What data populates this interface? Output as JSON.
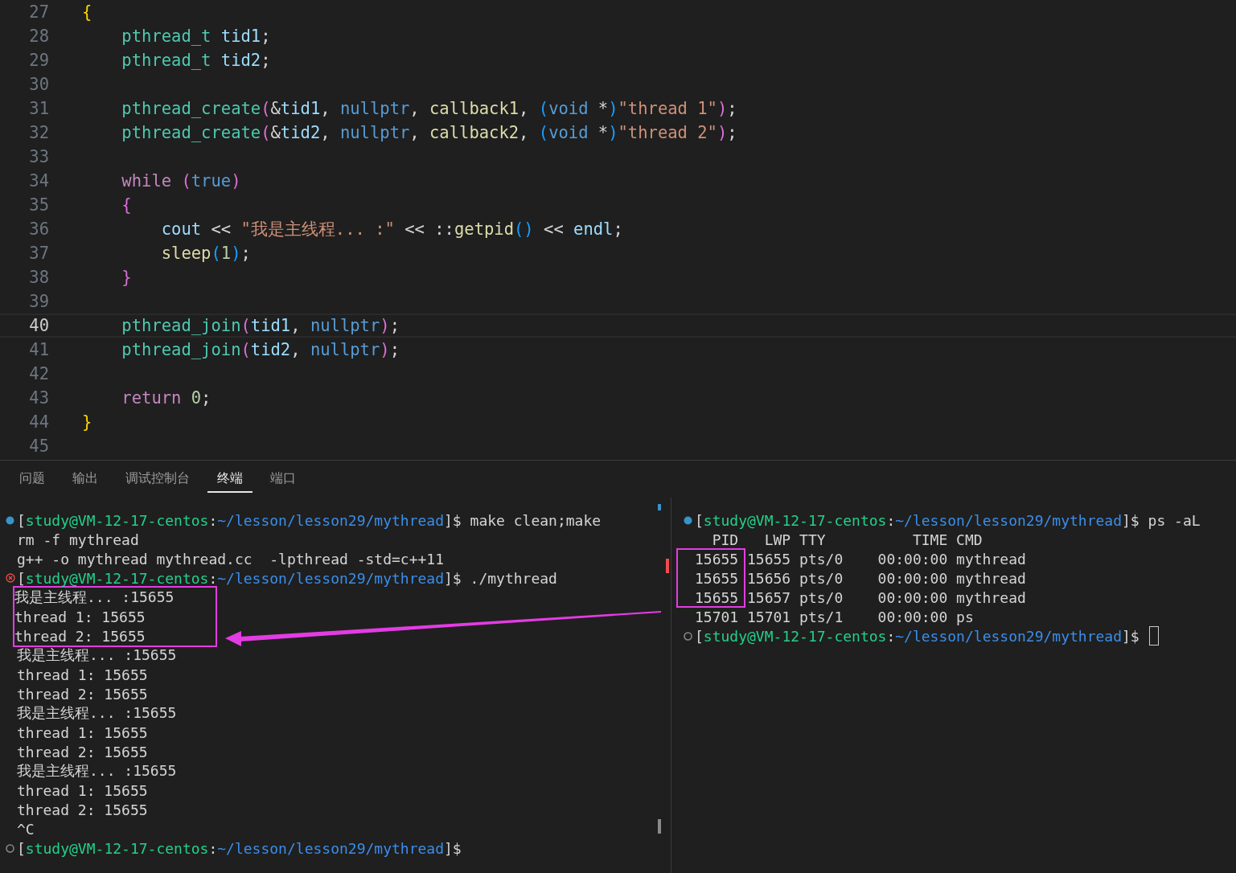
{
  "editor": {
    "lines": [
      {
        "number": "27",
        "current": false,
        "tokens": [
          {
            "kind": "b1",
            "text": "{"
          }
        ]
      },
      {
        "number": "28",
        "current": false,
        "tokens": [
          {
            "kind": "type",
            "text": "    pthread_t"
          },
          {
            "kind": "var",
            "text": " tid1"
          },
          {
            "kind": "p",
            "text": ";"
          }
        ]
      },
      {
        "number": "29",
        "current": false,
        "tokens": [
          {
            "kind": "type",
            "text": "    pthread_t"
          },
          {
            "kind": "var",
            "text": " tid2"
          },
          {
            "kind": "p",
            "text": ";"
          }
        ]
      },
      {
        "number": "30",
        "current": false
      },
      {
        "number": "31",
        "current": false,
        "tokens": [
          {
            "kind": "type",
            "text": "    pthread_create"
          },
          {
            "kind": "b2",
            "text": "("
          },
          {
            "kind": "p",
            "text": "&"
          },
          {
            "kind": "var",
            "text": "tid1"
          },
          {
            "kind": "p",
            "text": ","
          },
          {
            "kind": "kw",
            "text": " nullptr"
          },
          {
            "kind": "p",
            "text": ","
          },
          {
            "kind": "func",
            "text": " callback1"
          },
          {
            "kind": "p",
            "text": ","
          },
          {
            "kind": "b3",
            "text": " ("
          },
          {
            "kind": "kw",
            "text": "void"
          },
          {
            "kind": "p",
            "text": " *"
          },
          {
            "kind": "b3",
            "text": ")"
          },
          {
            "kind": "str",
            "text": "\"thread 1\""
          },
          {
            "kind": "b2",
            "text": ")"
          },
          {
            "kind": "p",
            "text": ";"
          }
        ]
      },
      {
        "number": "32",
        "current": false,
        "tokens": [
          {
            "kind": "type",
            "text": "    pthread_create"
          },
          {
            "kind": "b2",
            "text": "("
          },
          {
            "kind": "p",
            "text": "&"
          },
          {
            "kind": "var",
            "text": "tid2"
          },
          {
            "kind": "p",
            "text": ","
          },
          {
            "kind": "kw",
            "text": " nullptr"
          },
          {
            "kind": "p",
            "text": ","
          },
          {
            "kind": "func",
            "text": " callback2"
          },
          {
            "kind": "p",
            "text": ","
          },
          {
            "kind": "b3",
            "text": " ("
          },
          {
            "kind": "kw",
            "text": "void"
          },
          {
            "kind": "p",
            "text": " *"
          },
          {
            "kind": "b3",
            "text": ")"
          },
          {
            "kind": "str",
            "text": "\"thread 2\""
          },
          {
            "kind": "b2",
            "text": ")"
          },
          {
            "kind": "p",
            "text": ";"
          }
        ]
      },
      {
        "number": "33",
        "current": false
      },
      {
        "number": "34",
        "current": false,
        "tokens": [
          {
            "kind": "ctrl",
            "text": "    while"
          },
          {
            "kind": "b2",
            "text": " ("
          },
          {
            "kind": "kw",
            "text": "true"
          },
          {
            "kind": "b2",
            "text": ")"
          }
        ]
      },
      {
        "number": "35",
        "current": false,
        "tokens": [
          {
            "kind": "b2",
            "text": "    {"
          }
        ]
      },
      {
        "number": "36",
        "current": false,
        "tokens": [
          {
            "kind": "var",
            "text": "        cout"
          },
          {
            "kind": "p",
            "text": " << "
          },
          {
            "kind": "str",
            "text": "\"我是主线程... :\""
          },
          {
            "kind": "p",
            "text": " << ::"
          },
          {
            "kind": "func",
            "text": "getpid"
          },
          {
            "kind": "b3",
            "text": "()"
          },
          {
            "kind": "p",
            "text": " << "
          },
          {
            "kind": "var",
            "text": "endl"
          },
          {
            "kind": "p",
            "text": ";"
          }
        ]
      },
      {
        "number": "37",
        "current": false,
        "tokens": [
          {
            "kind": "func",
            "text": "        sleep"
          },
          {
            "kind": "b3",
            "text": "("
          },
          {
            "kind": "num",
            "text": "1"
          },
          {
            "kind": "b3",
            "text": ")"
          },
          {
            "kind": "p",
            "text": ";"
          }
        ]
      },
      {
        "number": "38",
        "current": false,
        "tokens": [
          {
            "kind": "b2",
            "text": "    }"
          }
        ]
      },
      {
        "number": "39",
        "current": false
      },
      {
        "number": "40",
        "current": true,
        "tokens": [
          {
            "kind": "type",
            "text": "    pthread_join"
          },
          {
            "kind": "b2",
            "text": "("
          },
          {
            "kind": "var",
            "text": "tid1"
          },
          {
            "kind": "p",
            "text": ","
          },
          {
            "kind": "kw",
            "text": " nullptr"
          },
          {
            "kind": "b2",
            "text": ")"
          },
          {
            "kind": "p",
            "text": ";"
          }
        ]
      },
      {
        "number": "41",
        "current": false,
        "tokens": [
          {
            "kind": "type",
            "text": "    pthread_join"
          },
          {
            "kind": "b2",
            "text": "("
          },
          {
            "kind": "var",
            "text": "tid2"
          },
          {
            "kind": "p",
            "text": ","
          },
          {
            "kind": "kw",
            "text": " nullptr"
          },
          {
            "kind": "b2",
            "text": ")"
          },
          {
            "kind": "p",
            "text": ";"
          }
        ]
      },
      {
        "number": "42",
        "current": false
      },
      {
        "number": "43",
        "current": false,
        "tokens": [
          {
            "kind": "ctrl",
            "text": "    return"
          },
          {
            "kind": "num",
            "text": " 0"
          },
          {
            "kind": "p",
            "text": ";"
          }
        ]
      },
      {
        "number": "44",
        "current": false,
        "tokens": [
          {
            "kind": "b1",
            "text": "}"
          }
        ]
      },
      {
        "number": "45",
        "current": false
      }
    ]
  },
  "panel": {
    "tabs": [
      {
        "label": "问题",
        "selected": false
      },
      {
        "label": "输出",
        "selected": false
      },
      {
        "label": "调试控制台",
        "selected": false
      },
      {
        "label": "终端",
        "selected": true
      },
      {
        "label": "端口",
        "selected": false
      }
    ],
    "terminals": [
      {
        "groups": [
          {
            "kind": "plain",
            "lines": [
              {
                "kind": "success",
                "tokens": [
                  {
                    "kind": "p",
                    "text": "["
                  },
                  {
                    "kind": "host",
                    "text": "study@VM-12-17-centos"
                  },
                  {
                    "kind": "p",
                    "text": ":"
                  },
                  {
                    "kind": "path",
                    "text": "~/lesson/lesson29/mythread"
                  },
                  {
                    "kind": "p",
                    "text": "]$ make clean;make"
                  }
                ]
              },
              {
                "kind": "plain",
                "tokens": [
                  {
                    "kind": "p",
                    "text": "rm -f mythread"
                  }
                ]
              },
              {
                "kind": "plain",
                "tokens": [
                  {
                    "kind": "p",
                    "text": "g++ -o mythread mythread.cc  -lpthread -std=c++11"
                  }
                ]
              },
              {
                "kind": "error",
                "tokens": [
                  {
                    "kind": "p",
                    "text": "["
                  },
                  {
                    "kind": "host",
                    "text": "study@VM-12-17-centos"
                  },
                  {
                    "kind": "p",
                    "text": ":"
                  },
                  {
                    "kind": "path",
                    "text": "~/lesson/lesson29/mythread"
                  },
                  {
                    "kind": "p",
                    "text": "]$ ./mythread"
                  }
                ]
              }
            ]
          },
          {
            "kind": "boxed",
            "lines": [
              {
                "kind": "plain",
                "tokens": [
                  {
                    "kind": "p",
                    "text": "我是主线程... :15655"
                  }
                ]
              },
              {
                "kind": "plain",
                "tokens": [
                  {
                    "kind": "p",
                    "text": "thread 1: 15655"
                  }
                ]
              },
              {
                "kind": "plain",
                "tokens": [
                  {
                    "kind": "p",
                    "text": "thread 2: 15655"
                  }
                ]
              }
            ]
          },
          {
            "kind": "plain",
            "lines": [
              {
                "kind": "plain",
                "tokens": [
                  {
                    "kind": "p",
                    "text": "我是主线程... :15655"
                  }
                ]
              },
              {
                "kind": "plain",
                "tokens": [
                  {
                    "kind": "p",
                    "text": "thread 1: 15655"
                  }
                ]
              },
              {
                "kind": "plain",
                "tokens": [
                  {
                    "kind": "p",
                    "text": "thread 2: 15655"
                  }
                ]
              },
              {
                "kind": "plain",
                "tokens": [
                  {
                    "kind": "p",
                    "text": "我是主线程... :15655"
                  }
                ]
              },
              {
                "kind": "plain",
                "tokens": [
                  {
                    "kind": "p",
                    "text": "thread 1: 15655"
                  }
                ]
              },
              {
                "kind": "plain",
                "tokens": [
                  {
                    "kind": "p",
                    "text": "thread 2: 15655"
                  }
                ]
              },
              {
                "kind": "plain",
                "tokens": [
                  {
                    "kind": "p",
                    "text": "我是主线程... :15655"
                  }
                ]
              },
              {
                "kind": "plain",
                "tokens": [
                  {
                    "kind": "p",
                    "text": "thread 1: 15655"
                  }
                ]
              },
              {
                "kind": "plain",
                "tokens": [
                  {
                    "kind": "p",
                    "text": "thread 2: 15655"
                  }
                ]
              },
              {
                "kind": "plain",
                "tokens": [
                  {
                    "kind": "p",
                    "text": "^C"
                  }
                ]
              },
              {
                "kind": "idle",
                "tokens": [
                  {
                    "kind": "p",
                    "text": "["
                  },
                  {
                    "kind": "host",
                    "text": "study@VM-12-17-centos"
                  },
                  {
                    "kind": "p",
                    "text": ":"
                  },
                  {
                    "kind": "path",
                    "text": "~/lesson/lesson29/mythread"
                  },
                  {
                    "kind": "p",
                    "text": "]$"
                  }
                ]
              }
            ]
          }
        ]
      },
      {
        "groups": [
          {
            "kind": "plain",
            "lines": [
              {
                "kind": "success",
                "tokens": [
                  {
                    "kind": "p",
                    "text": "["
                  },
                  {
                    "kind": "host",
                    "text": "study@VM-12-17-centos"
                  },
                  {
                    "kind": "p",
                    "text": ":"
                  },
                  {
                    "kind": "path",
                    "text": "~/lesson/lesson29/mythread"
                  },
                  {
                    "kind": "p",
                    "text": "]$ ps -aL"
                  }
                ]
              },
              {
                "kind": "plain",
                "tokens": [
                  {
                    "kind": "p",
                    "text": "  PID   LWP TTY          TIME CMD"
                  }
                ]
              }
            ]
          },
          {
            "kind": "pidbox",
            "lines": [
              {
                "kind": "plain",
                "tokens": [
                  {
                    "kind": "p",
                    "text": "15655 15655 pts/0    00:00:00 mythread"
                  }
                ]
              },
              {
                "kind": "plain",
                "tokens": [
                  {
                    "kind": "p",
                    "text": "15655 15656 pts/0    00:00:00 mythread"
                  }
                ]
              },
              {
                "kind": "plain",
                "tokens": [
                  {
                    "kind": "p",
                    "text": "15655 15657 pts/0    00:00:00 mythread"
                  }
                ]
              }
            ]
          },
          {
            "kind": "plain",
            "lines": [
              {
                "kind": "plain",
                "tokens": [
                  {
                    "kind": "p",
                    "text": "15701 15701 pts/1    00:00:00 ps"
                  }
                ]
              },
              {
                "kind": "idle",
                "cursor": true,
                "tokens": [
                  {
                    "kind": "p",
                    "text": "["
                  },
                  {
                    "kind": "host",
                    "text": "study@VM-12-17-centos"
                  },
                  {
                    "kind": "p",
                    "text": ":"
                  },
                  {
                    "kind": "path",
                    "text": "~/lesson/lesson29/mythread"
                  },
                  {
                    "kind": "p",
                    "text": "]$"
                  }
                ]
              }
            ]
          }
        ]
      }
    ]
  }
}
